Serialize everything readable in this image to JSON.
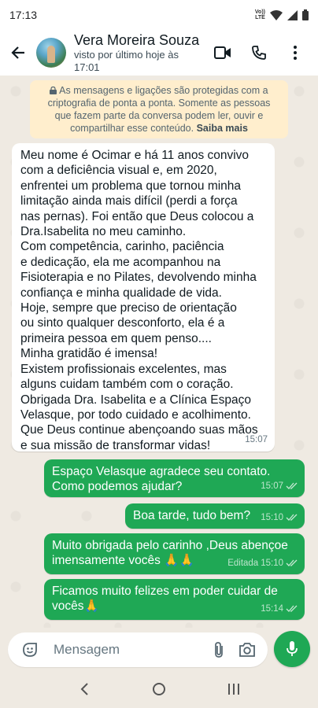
{
  "status_bar": {
    "time": "17:13",
    "volte_line1": "Vo))",
    "volte_line2": "LTE"
  },
  "header": {
    "contact_name": "Vera Moreira Souza",
    "last_seen": "visto por último hoje às 17:01"
  },
  "encryption_notice": {
    "line1": "As mensagens e ligações são protegidas com a",
    "line2": "criptografia de ponta a ponta. Somente as pessoas",
    "line3": "que fazem parte da conversa podem ler, ouvir e",
    "line4": "compartilhar esse conteúdo.",
    "link": "Saiba mais"
  },
  "messages": {
    "incoming": {
      "lines": [
        "Meu nome é Ocimar e há 11 anos convivo",
        "com a deficiência visual e, em 2020,",
        "enfrentei um problema que tornou minha",
        "limitação ainda mais difícil (perdi a força",
        "nas pernas). Foi então que Deus colocou a",
        "Dra.Isabelita no meu caminho.",
        "Com competência, carinho, paciência",
        "e dedicação, ela me acompanhou na",
        "Fisioterapia e no Pilates, devolvendo minha",
        "confiança e minha qualidade de vida.",
        "Hoje, sempre que preciso de orientação",
        "ou sinto qualquer desconforto, ela é a",
        "primeira pessoa em quem penso....",
        "Minha gratidão é imensa!",
        "Existem profissionais excelentes, mas",
        "alguns cuidam também com o coração.",
        "Obrigada Dra. Isabelita e a Clínica Espaço",
        "Velasque, por todo cuidado e acolhimento.",
        "Que Deus continue abençoando suas mãos",
        "e sua missão de transformar vidas!"
      ],
      "time": "15:07"
    },
    "outgoing": [
      {
        "lines": [
          "Espaço Velasque agradece seu contato.",
          "Como podemos ajudar?"
        ],
        "time": "15:07",
        "edited": ""
      },
      {
        "lines": [
          "Boa tarde, tudo bem?"
        ],
        "time": "15:10",
        "edited": ""
      },
      {
        "lines": [
          "Muito obrigada pelo carinho ,Deus abençoe",
          "imensamente vocês 🙏🙏"
        ],
        "time": "15:10",
        "edited": "Editada"
      },
      {
        "lines": [
          "Ficamos muito felizes em poder cuidar de",
          "vocês🙏"
        ],
        "time": "15:14",
        "edited": ""
      }
    ]
  },
  "composer": {
    "placeholder": "Mensagem"
  },
  "colors": {
    "outgoing_bubble": "#1fa855",
    "incoming_bubble": "#ffffff",
    "chat_bg": "#efeae2",
    "encryption_bg": "#ffeecd"
  },
  "icons": [
    "back-arrow-icon",
    "video-call-icon",
    "voice-call-icon",
    "more-vert-icon",
    "sticker-icon",
    "attach-icon",
    "camera-icon",
    "mic-icon",
    "lock-icon",
    "read-ticks-icon",
    "nav-back-icon",
    "nav-home-icon",
    "nav-recents-icon"
  ]
}
